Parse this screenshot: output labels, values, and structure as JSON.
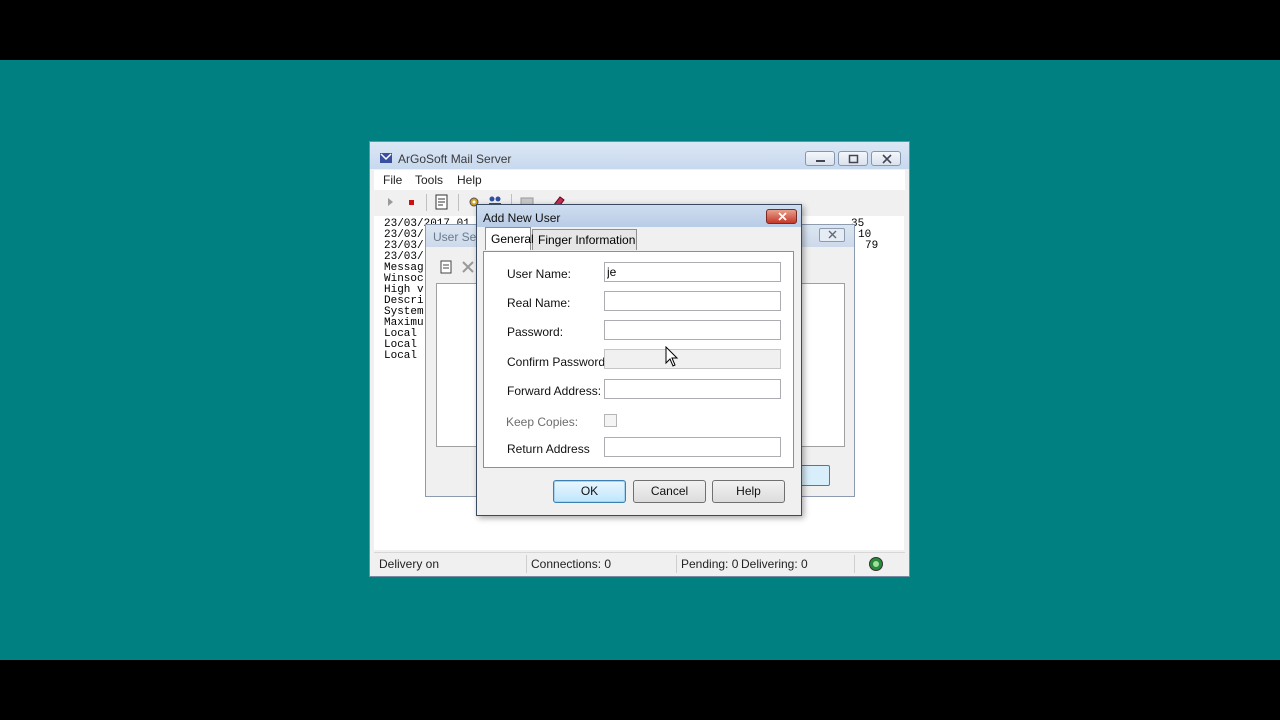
{
  "main_window": {
    "title": "ArGoSoft Mail Server",
    "menu": [
      "File",
      "Tools",
      "Help"
    ],
    "log_lines": [
      "23/03/2017 01",
      "23/03/",
      "23/03/",
      "23/03/",
      "Messag",
      "Winsoc",
      "High v",
      "Descri",
      "System",
      "Maximu",
      "Local",
      "Local",
      "Local"
    ],
    "log_right": [
      "35",
      "10",
      "79"
    ],
    "status": {
      "delivery": "Delivery on",
      "connections": "Connections: 0",
      "pending": "Pending: 0",
      "delivering": "Delivering: 0"
    }
  },
  "user_setup": {
    "title": "User Setu"
  },
  "dialog": {
    "title": "Add New User",
    "tabs": [
      "General",
      "Finger Information"
    ],
    "fields": {
      "user_name_label": "User Name:",
      "user_name_value": "je",
      "real_name_label": "Real Name:",
      "password_label": "Password:",
      "confirm_password_label": "Confirm Password:",
      "forward_address_label": "Forward Address:",
      "keep_copies_label": "Keep Copies:",
      "return_address_label": "Return Address"
    },
    "buttons": {
      "ok": "OK",
      "cancel": "Cancel",
      "help": "Help"
    }
  },
  "icons": [
    "app-icon",
    "play-icon",
    "stop-icon",
    "new-user-icon",
    "settings-icon",
    "users-icon",
    "mail-icon",
    "book-icon",
    "network-status-icon",
    "add-icon",
    "delete-icon"
  ]
}
